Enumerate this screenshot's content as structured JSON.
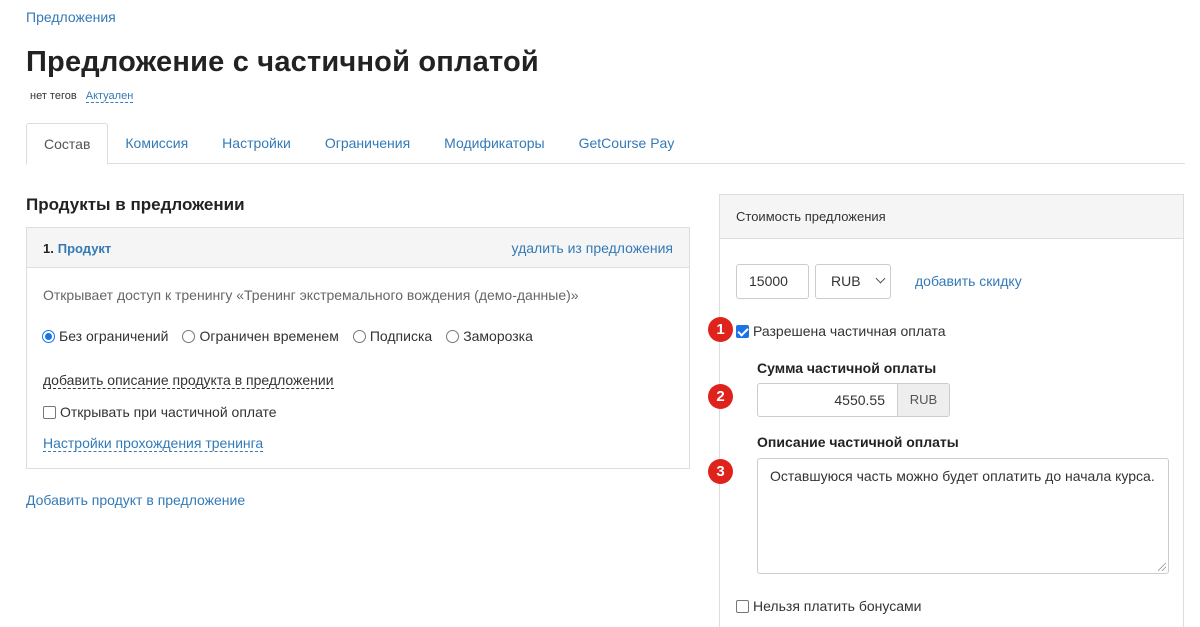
{
  "breadcrumb": {
    "label": "Предложения"
  },
  "page": {
    "title": "Предложение с частичной оплатой",
    "tags": "нет тегов",
    "status": "Актуален"
  },
  "tabs": [
    {
      "label": "Состав",
      "active": true
    },
    {
      "label": "Комиссия"
    },
    {
      "label": "Настройки"
    },
    {
      "label": "Ограничения"
    },
    {
      "label": "Модификаторы"
    },
    {
      "label": "GetCourse Pay"
    }
  ],
  "products_section": {
    "title": "Продукты в предложении",
    "product": {
      "number": "1.",
      "name": "Продукт",
      "remove_label": "удалить из предложения",
      "description": "Открывает доступ к тренингу «Тренинг экстремального вождения (демо-данные)»",
      "access_options": [
        {
          "label": "Без ограничений",
          "selected": true
        },
        {
          "label": "Ограничен временем",
          "selected": false
        },
        {
          "label": "Подписка",
          "selected": false
        },
        {
          "label": "Заморозка",
          "selected": false
        }
      ],
      "add_description_label": "добавить описание продукта в предложении",
      "open_on_partial_label": "Открывать при частичной оплате",
      "open_on_partial_checked": false,
      "training_settings_label": "Настройки прохождения тренинга"
    },
    "add_product_label": "Добавить продукт в предложение"
  },
  "price_panel": {
    "title": "Стоимость предложения",
    "price": "15000",
    "currency": "RUB",
    "add_discount_label": "добавить скидку",
    "partial_allowed_label": "Разрешена частичная оплата",
    "partial_allowed_checked": true,
    "partial_sum_label": "Сумма частичной оплаты",
    "partial_sum_value": "4550.55",
    "partial_sum_currency": "RUB",
    "partial_desc_label": "Описание частичной оплаты",
    "partial_desc_value": "Оставшуюся часть можно будет оплатить до начала курса.",
    "no_bonus_label": "Нельзя платить бонусами",
    "no_bonus_checked": false
  },
  "markers": [
    "1",
    "2",
    "3"
  ],
  "colors": {
    "accent": "#337ab7",
    "marker": "#e0221c",
    "checkbox": "#1a73e8"
  }
}
